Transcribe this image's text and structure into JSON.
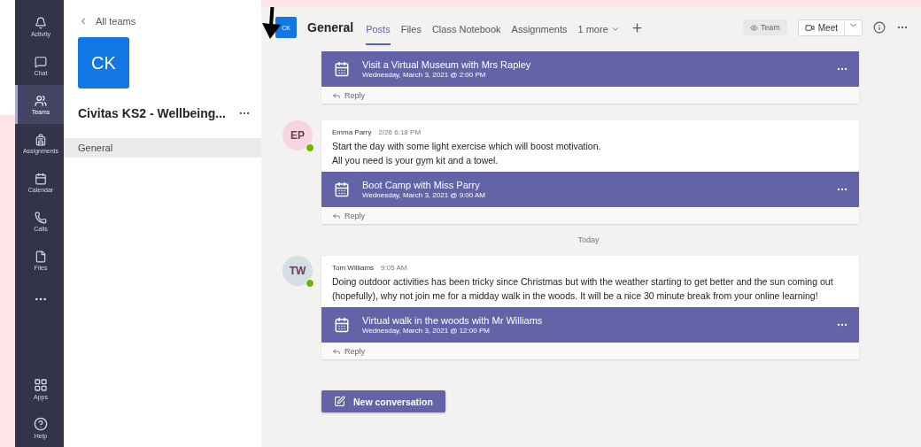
{
  "rail": {
    "items": [
      {
        "label": "Activity",
        "selected": false
      },
      {
        "label": "Chat",
        "selected": false
      },
      {
        "label": "Teams",
        "selected": true
      },
      {
        "label": "Assignments",
        "selected": false
      },
      {
        "label": "Calendar",
        "selected": false
      },
      {
        "label": "Calls",
        "selected": false
      },
      {
        "label": "Files",
        "selected": false
      }
    ],
    "bottom": [
      {
        "label": "Apps"
      },
      {
        "label": "Help"
      }
    ]
  },
  "team_panel": {
    "back": "All teams",
    "avatar": "CK",
    "name": "Civitas KS2 - Wellbeing...",
    "channels": [
      {
        "label": "General",
        "selected": true
      }
    ]
  },
  "header": {
    "avatar": "CK",
    "title": "General",
    "tabs": [
      {
        "kind": "tab",
        "label": "Posts",
        "selected": true
      },
      {
        "kind": "tab",
        "label": "Files",
        "selected": false
      },
      {
        "kind": "tab",
        "label": "Class Notebook",
        "selected": false
      },
      {
        "kind": "tab",
        "label": "Assignments",
        "selected": false
      },
      {
        "kind": "menu",
        "label": "1 more",
        "selected": false
      }
    ],
    "team_button": "Team",
    "meet_button": "Meet"
  },
  "feed": [
    {
      "kind": "post",
      "event": {
        "title": "Visit a Virtual Museum with Mrs Rapley",
        "date": "Wednesday, March 3, 2021 @ 2:00 PM"
      },
      "reply": "Reply"
    },
    {
      "kind": "post",
      "author": {
        "initials": "EP",
        "name": "Emma Parry",
        "color": "#f6d5e0",
        "online": true
      },
      "time": "2/26 6:18 PM",
      "body": [
        "Start the day with some light exercise which will boost motivation.",
        "All you need is your gym kit and a towel."
      ],
      "event": {
        "title": "Boot Camp with Miss Parry",
        "date": "Wednesday, March 3, 2021 @ 9:00 AM"
      },
      "reply": "Reply"
    },
    {
      "kind": "divider",
      "label": "Today"
    },
    {
      "kind": "post",
      "author": {
        "initials": "TW",
        "name": "Tom Williams",
        "color": "#d5dde5",
        "online": true
      },
      "time": "9:05 AM",
      "body": [
        "Doing outdoor activities has been tricky since Christmas but with the weather starting to get better and the sun coming out (hopefully), why not join me for a midday walk in the woods. It will be a nice 30 minute break from your online learning!"
      ],
      "event": {
        "title": "Virtual walk in the woods with Mr Williams",
        "date": "Wednesday, March 3, 2021 @ 12:00 PM"
      },
      "reply": "Reply"
    }
  ],
  "new_conversation": "New conversation"
}
